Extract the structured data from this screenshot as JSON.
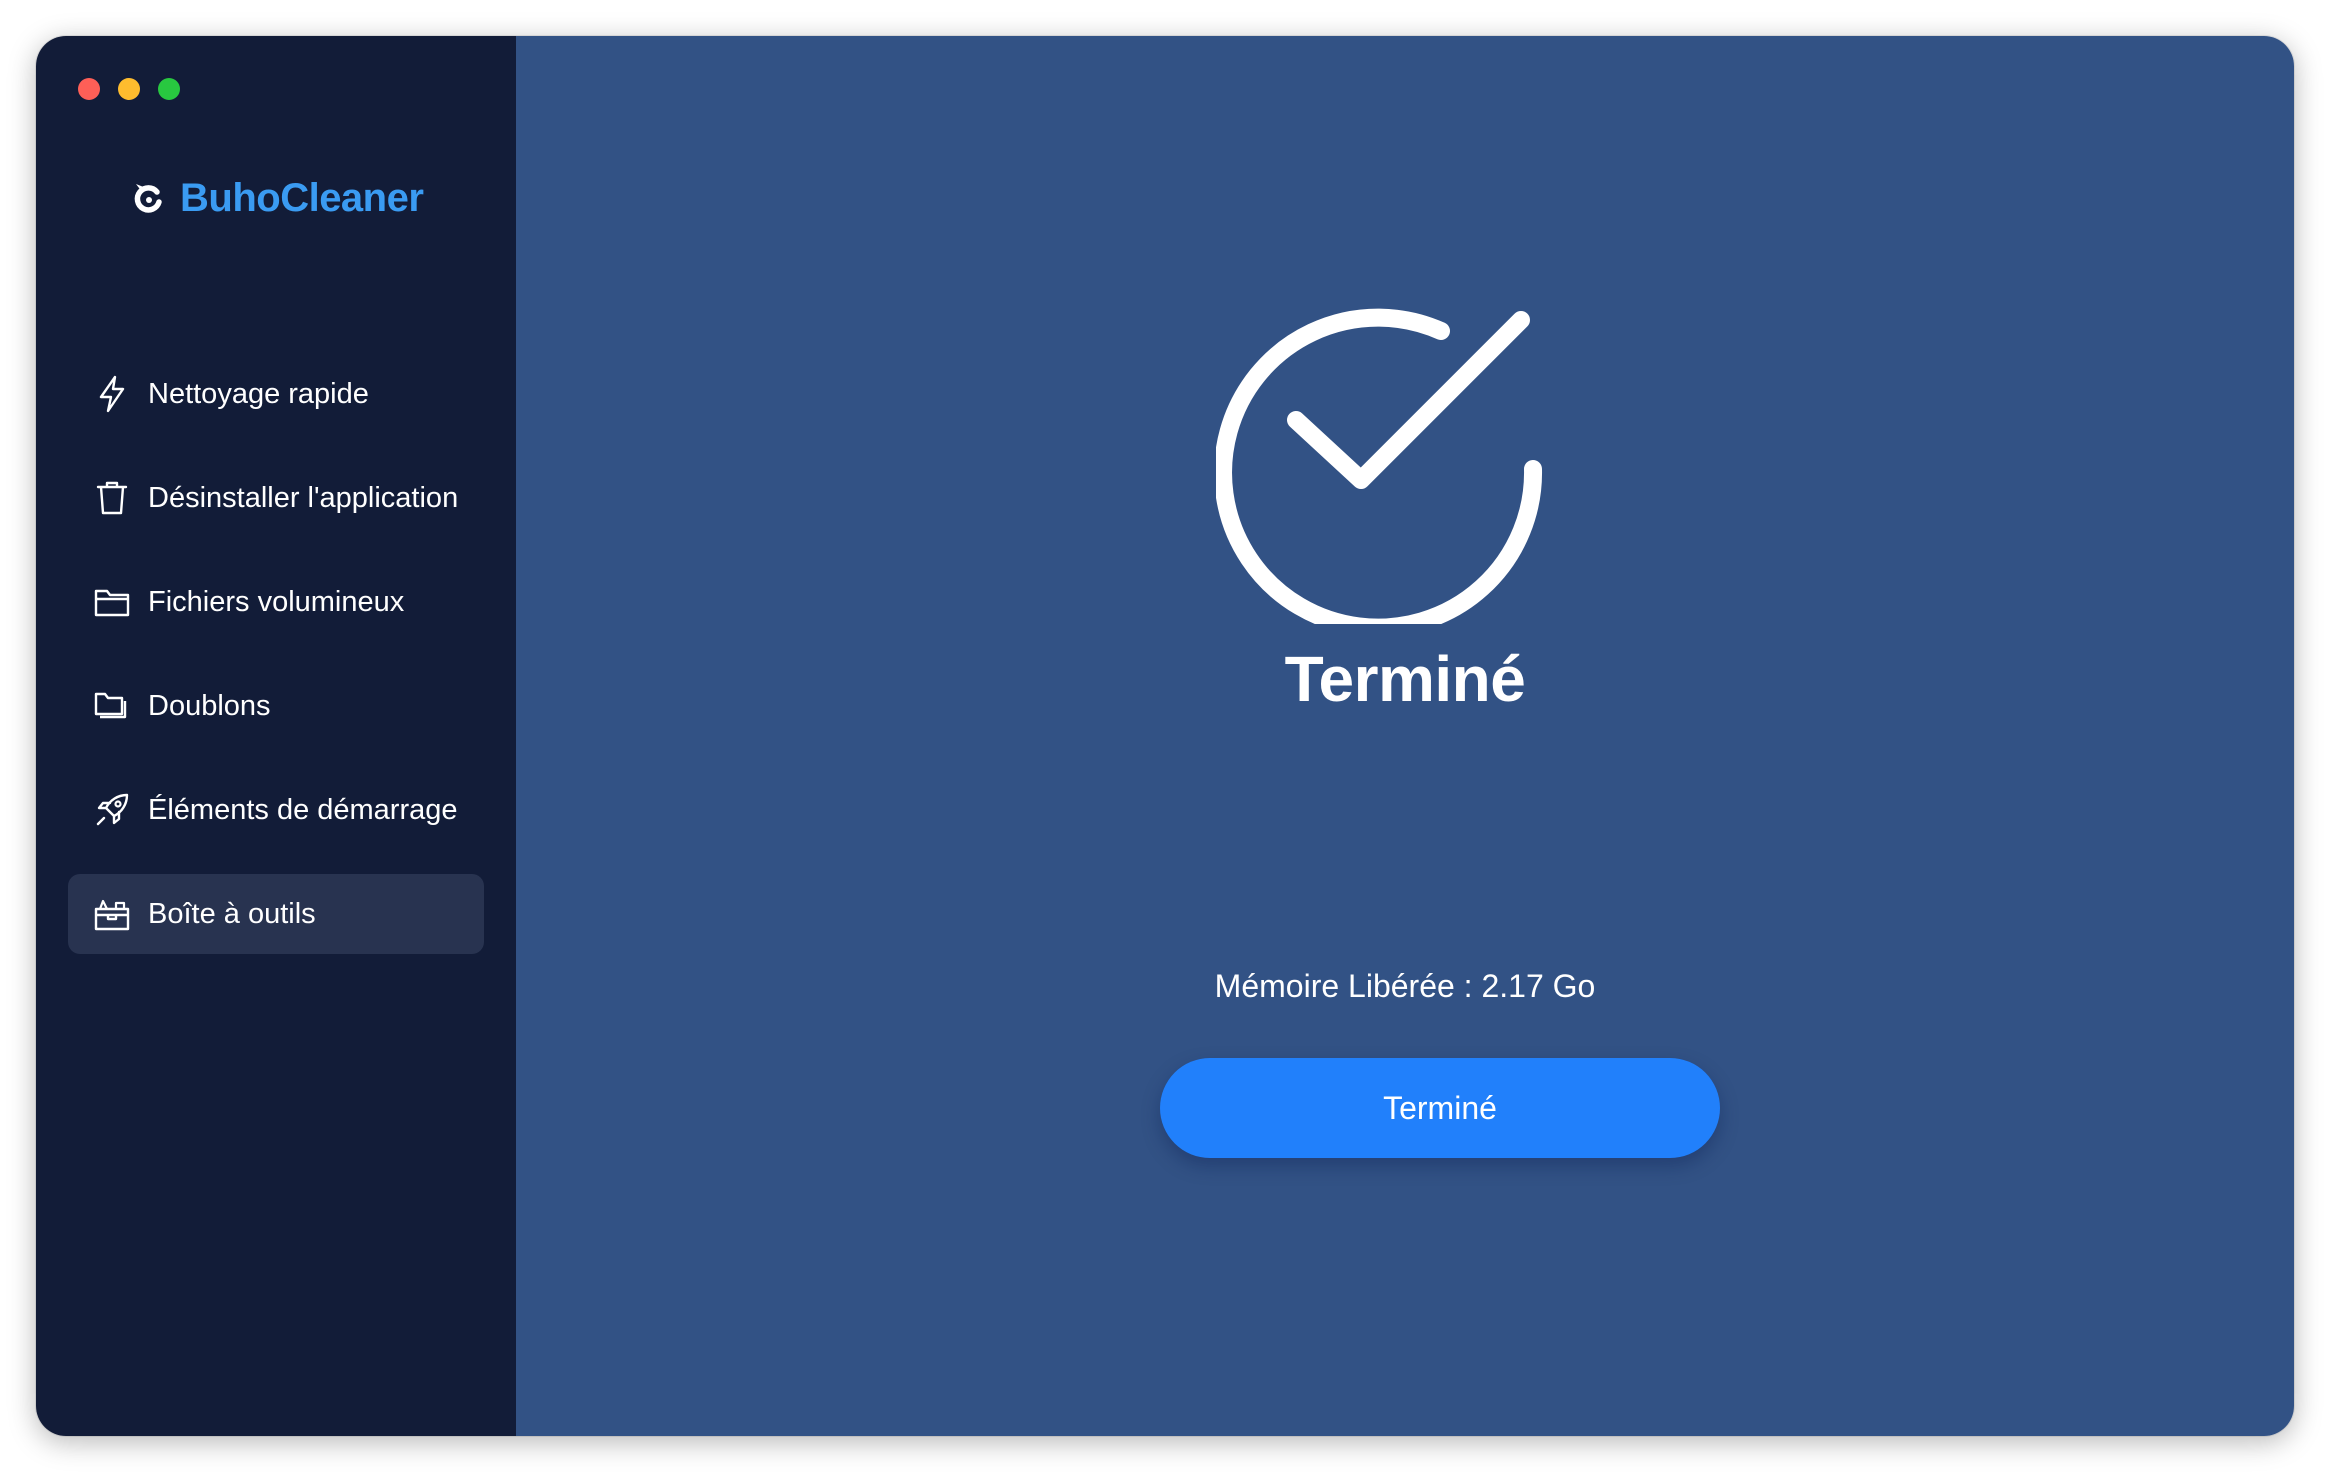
{
  "colors": {
    "sidebar_bg": "#121c38",
    "main_bg": "#325285",
    "active_item_bg": "#283350",
    "brand": "#3a9bf2",
    "button": "#2180fb",
    "traffic_red": "#fe5f57",
    "traffic_yellow": "#febc2e",
    "traffic_green": "#28c840"
  },
  "app": {
    "name": "BuhoCleaner",
    "logo_icon": "buho-logo-icon"
  },
  "sidebar": {
    "items": [
      {
        "label": "Nettoyage rapide",
        "icon": "lightning-icon",
        "active": false
      },
      {
        "label": "Désinstaller l'application",
        "icon": "trash-icon",
        "active": false
      },
      {
        "label": "Fichiers volumineux",
        "icon": "folder-icon",
        "active": false
      },
      {
        "label": "Doublons",
        "icon": "duplicate-folder-icon",
        "active": false
      },
      {
        "label": "Éléments de démarrage",
        "icon": "rocket-icon",
        "active": false
      },
      {
        "label": "Boîte à outils",
        "icon": "toolbox-icon",
        "active": true
      }
    ]
  },
  "main": {
    "status_icon": "check-circle-icon",
    "title": "Terminé",
    "memory_text": "Mémoire Libérée : 2.17 Go",
    "button_label": "Terminé"
  }
}
